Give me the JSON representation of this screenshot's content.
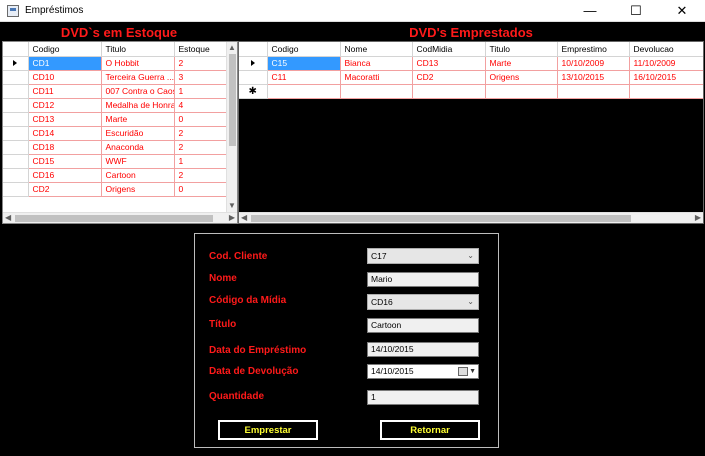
{
  "window": {
    "title": "Empréstimos",
    "minimize_glyph": "—",
    "maximize_glyph": "☐",
    "close_glyph": "✕"
  },
  "stock": {
    "title": "DVD`s em Estoque",
    "columns": [
      "Codigo",
      "Titulo",
      "Estoque"
    ],
    "rows": [
      [
        "CD1",
        "O Hobbit",
        "2"
      ],
      [
        "CD10",
        "Terceira Guerra ...",
        "3"
      ],
      [
        "CD11",
        "007 Contra o Caos",
        "1"
      ],
      [
        "CD12",
        "Medalha de Honra",
        "4"
      ],
      [
        "CD13",
        "Marte",
        "0"
      ],
      [
        "CD14",
        "Escuridão",
        "2"
      ],
      [
        "CD18",
        "Anaconda",
        "2"
      ],
      [
        "CD15",
        "WWF",
        "1"
      ],
      [
        "CD16",
        "Cartoon",
        "2"
      ],
      [
        "CD2",
        "Origens",
        "0"
      ]
    ]
  },
  "loans": {
    "title": "DVD's Emprestados",
    "columns": [
      "Codigo",
      "Nome",
      "CodMidia",
      "Titulo",
      "Emprestimo",
      "Devolucao"
    ],
    "rows": [
      [
        "C15",
        "Bianca",
        "CD13",
        "Marte",
        "10/10/2009",
        "11/10/2009"
      ],
      [
        "C11",
        "Macoratti",
        "CD2",
        "Origens",
        "13/10/2015",
        "16/10/2015"
      ]
    ],
    "new_row_marker": "✱"
  },
  "form": {
    "cod_cliente_label": "Cod. Cliente",
    "cod_cliente_value": "C17",
    "nome_label": "Nome",
    "nome_value": "Mario",
    "codigo_midia_label": "Código da Mídia",
    "codigo_midia_value": "CD16",
    "titulo_label": "Título",
    "titulo_value": "Cartoon",
    "data_emprestimo_label": "Data do Empréstimo",
    "data_emprestimo_value": "14/10/2015",
    "data_devolucao_label": "Data de Devolução",
    "data_devolucao_value": "14/10/2015",
    "quantidade_label": "Quantidade",
    "quantidade_value": "1",
    "emprestar_label": "Emprestar",
    "retornar_label": "Retornar"
  },
  "icons": {
    "app": "window-app-icon",
    "row_pointer": "row-pointer-icon",
    "dropdown": "chevron-down-icon",
    "calendar": "calendar-icon"
  },
  "colors": {
    "background": "#000000",
    "label_red": "#ff1a1a",
    "button_text": "#ffff33",
    "selection": "#3399ff"
  }
}
